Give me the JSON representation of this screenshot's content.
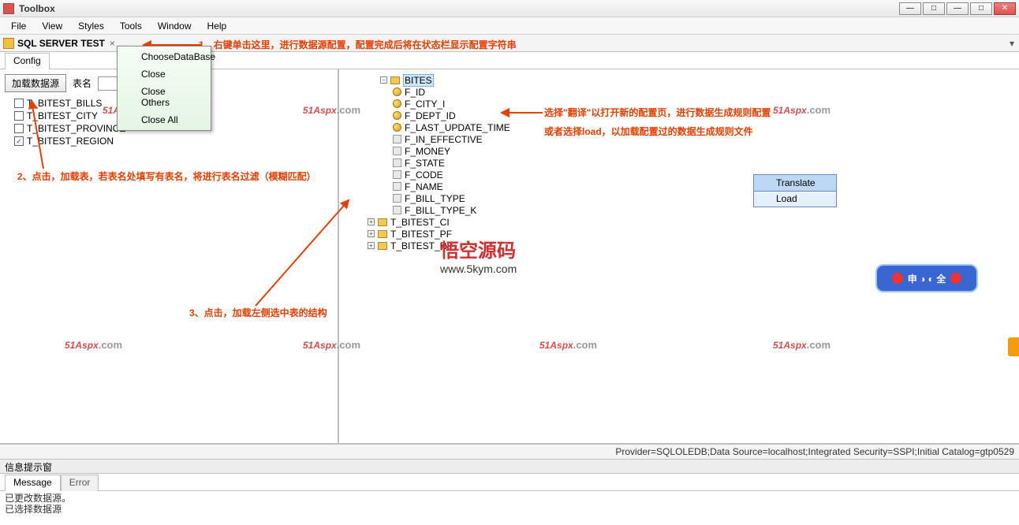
{
  "title": "Toolbox",
  "menu": {
    "file": "File",
    "view": "View",
    "styles": "Styles",
    "tools": "Tools",
    "window": "Window",
    "help": "Help"
  },
  "doc_tab": {
    "title": "SQL SERVER TEST",
    "close": "×"
  },
  "cfg_tab": "Config",
  "context_menu1": {
    "choose": "ChooseDataBase",
    "close": "Close",
    "close_others": "Close Others",
    "close_all": "Close All"
  },
  "left": {
    "load_btn": "加载数据源",
    "tblname_label": "表名",
    "tblname_value": "",
    "tables": [
      {
        "checked": false,
        "name": "T_BITEST_BILLS"
      },
      {
        "checked": false,
        "name": "T_BITEST_CITY"
      },
      {
        "checked": false,
        "name": "T_BITEST_PROVINCE"
      },
      {
        "checked": true,
        "name": "T_BITEST_REGION"
      }
    ]
  },
  "right": {
    "root": "BITES",
    "cols": [
      {
        "k": true,
        "n": "F_ID"
      },
      {
        "k": true,
        "n": "F_CITY_I"
      },
      {
        "k": true,
        "n": "F_DEPT_ID"
      },
      {
        "k": true,
        "n": "F_LAST_UPDATE_TIME"
      },
      {
        "k": false,
        "n": "F_IN_EFFECTIVE"
      },
      {
        "k": false,
        "n": "F_MONEY"
      },
      {
        "k": false,
        "n": "F_STATE"
      },
      {
        "k": false,
        "n": "F_CODE"
      },
      {
        "k": false,
        "n": "F_NAME"
      },
      {
        "k": false,
        "n": "F_BILL_TYPE"
      },
      {
        "k": false,
        "n": "F_BILL_TYPE_K"
      }
    ],
    "siblings": [
      "T_BITEST_CI",
      "T_BITEST_PF",
      "T_BITEST_RI"
    ]
  },
  "context_menu2": {
    "translate": "Translate",
    "load": "Load"
  },
  "annotations": {
    "a1": "1、右键单击这里，进行数据源配置，配置完成后将在状态栏显示配置字符串",
    "a2": "2、点击，加载表，若表名处填写有表名，将进行表名过滤（模糊匹配）",
    "a3": "3、点击，加载左侧选中表的结构",
    "a4a": "选择\"翻译\"以打开新的配置页，进行数据生成规则配置",
    "a4b": "或者选择load，以加载配置过的数据生成规则文件"
  },
  "status": "Provider=SQLOLEDB;Data Source=localhost;Integrated Security=SSPI;Initial Catalog=gtp0529",
  "info_hdr": "信息提示窗",
  "msg_tabs": {
    "message": "Message",
    "error": "Error"
  },
  "messages": [
    "已更改数据源。",
    "已选择数据源"
  ],
  "watermarks": {
    "aspx": "51Aspx",
    "dotcom": ".com",
    "wk_cn": "悟空源码",
    "wk_url": "www.5kym.com",
    "ad": "申 ◑ ◐ 全"
  }
}
